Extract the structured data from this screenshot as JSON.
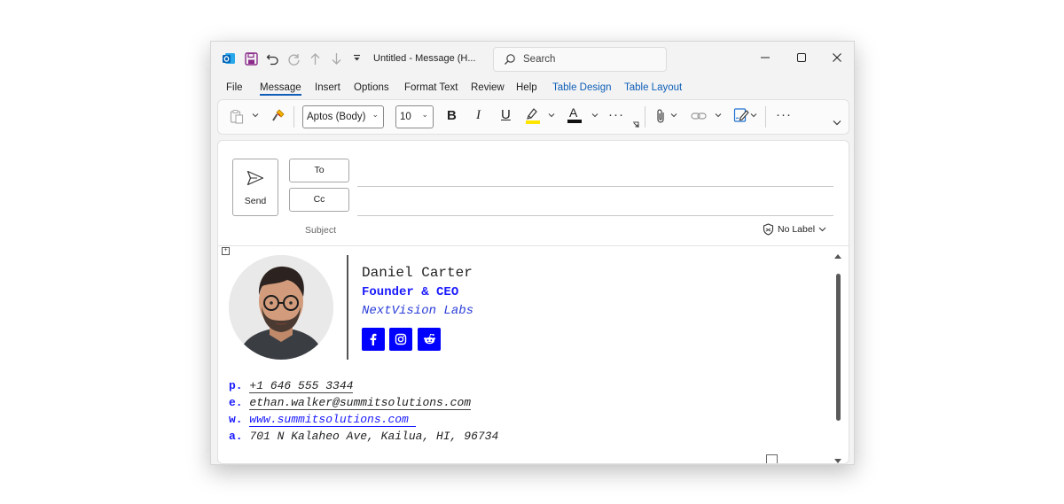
{
  "window": {
    "title": "Untitled  -  Message (H..."
  },
  "search": {
    "placeholder": "Search"
  },
  "menu": {
    "items": [
      "File",
      "Message",
      "Insert",
      "Options",
      "Format Text",
      "Review",
      "Help",
      "Table Design",
      "Table Layout"
    ],
    "active": "Message"
  },
  "ribbon": {
    "font_name": "Aptos (Body)",
    "font_size": "10",
    "bold": "B",
    "italic": "I",
    "underline": "U",
    "more": "···"
  },
  "compose": {
    "send_label": "Send",
    "to_label": "To",
    "cc_label": "Cc",
    "subject_label": "Subject",
    "label_dropdown": "No Label"
  },
  "signature": {
    "name": "Daniel Carter",
    "title": "Founder & CEO",
    "company": "NextVision Labs",
    "social": [
      "facebook-icon",
      "instagram-icon",
      "reddit-icon"
    ],
    "contacts": [
      {
        "key": "p.",
        "value": "+1 646 555 3344"
      },
      {
        "key": "e.",
        "value": "ethan.walker@summitsolutions.com"
      },
      {
        "key": "w.",
        "value": "www.summitsolutions.com "
      },
      {
        "key": "a.",
        "value": "701 N Kalaheo Ave, Kailua, HI, 96734"
      }
    ]
  },
  "colors": {
    "accent": "#0f5fb8",
    "signature_blue": "#0000ff",
    "outlook_blue": "#0364b8",
    "save_purple": "#8b2a8b"
  }
}
